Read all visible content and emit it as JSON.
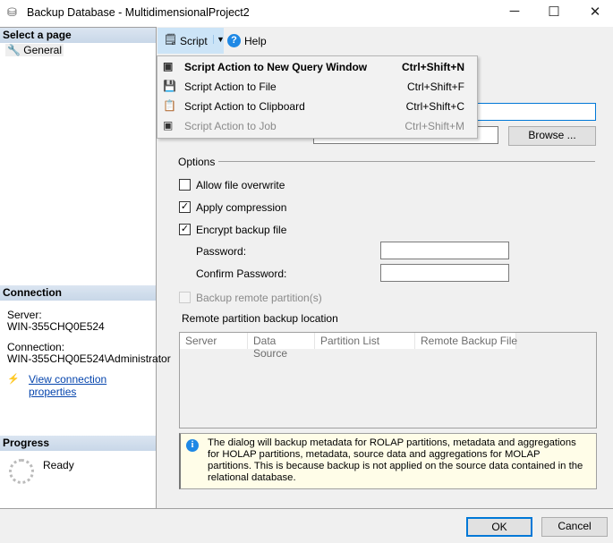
{
  "window": {
    "title": "Backup Database - MultidimensionalProject2",
    "minimize": "─",
    "maximize": "☐",
    "close": "✕"
  },
  "sidebar": {
    "select_page": "Select a page",
    "pages": [
      {
        "label": "General"
      }
    ],
    "connection_header": "Connection",
    "server_label": "Server:",
    "server_value": "WIN-355CHQ0E524",
    "connection_label": "Connection:",
    "connection_value": "WIN-355CHQ0E524\\Administrator",
    "view_connection": "View connection properties",
    "progress_header": "Progress",
    "progress_status": "Ready"
  },
  "toolbar": {
    "script": "Script",
    "help": "Help"
  },
  "script_menu": [
    {
      "label": "Script Action to New Query Window",
      "shortcut": "Ctrl+Shift+N",
      "enabled": true,
      "bold": true
    },
    {
      "label": "Script Action to File",
      "shortcut": "Ctrl+Shift+F",
      "enabled": true
    },
    {
      "label": "Script Action to Clipboard",
      "shortcut": "Ctrl+Shift+C",
      "enabled": true
    },
    {
      "label": "Script Action to Job",
      "shortcut": "Ctrl+Shift+M",
      "enabled": false
    }
  ],
  "form": {
    "browse": "Browse ...",
    "options": "Options",
    "allow_overwrite": {
      "label": "Allow file overwrite",
      "checked": false
    },
    "apply_compression": {
      "label": "Apply compression",
      "checked": true
    },
    "encrypt": {
      "label": "Encrypt backup file",
      "checked": true
    },
    "password_label": "Password:",
    "confirm_label": "Confirm Password:",
    "remote_partitions": {
      "label": "Backup remote partition(s)",
      "checked": false,
      "enabled": false
    },
    "remote_location": "Remote partition backup location",
    "columns": [
      "Server",
      "Data Source",
      "Partition List",
      "Remote Backup File"
    ],
    "info": "The dialog will backup metadata for ROLAP partitions, metadata and aggregations for HOLAP partitions, metadata, source data and aggregations for MOLAP partitions. This is because backup is not applied on the source data contained in the relational database."
  },
  "footer": {
    "ok": "OK",
    "cancel": "Cancel"
  }
}
